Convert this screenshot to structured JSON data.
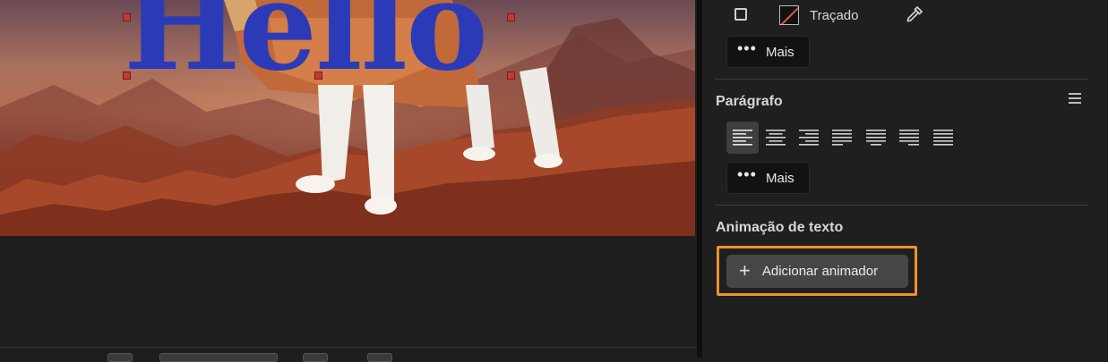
{
  "canvas": {
    "text_layer": "Hello"
  },
  "panel": {
    "stroke": {
      "label": "Traçado"
    },
    "more_button_1": "Mais",
    "paragraph": {
      "title": "Parágrafo",
      "alignment_options": [
        "align-left",
        "align-center",
        "align-right",
        "justify-last-left",
        "justify-last-center",
        "justify-last-right",
        "justify-all"
      ],
      "selected_alignment": "align-left"
    },
    "more_button_2": "Mais",
    "text_animation": {
      "title": "Animação de texto",
      "add_button": "Adicionar animador"
    }
  },
  "colors": {
    "text_fill": "#2b3bb8",
    "highlight": "#f0922a",
    "panel_bg": "#1f1f1f"
  }
}
